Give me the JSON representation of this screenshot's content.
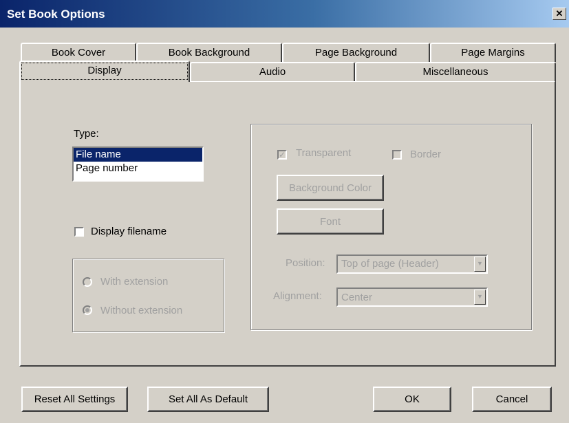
{
  "window": {
    "title": "Set Book Options",
    "close_glyph": "✕"
  },
  "tabs": {
    "row_back": [
      "Book Cover",
      "Book Background",
      "Page Background",
      "Page Margins"
    ],
    "row_front": [
      "Display",
      "Audio",
      "Miscellaneous"
    ],
    "selected": "Display"
  },
  "display": {
    "type_label": "Type:",
    "type_options": [
      "File name",
      "Page number"
    ],
    "type_selected": "File name",
    "display_filename_label": "Display filename",
    "display_filename_checked": false,
    "with_extension_label": "With extension",
    "without_extension_label": "Without extension",
    "extension_selected": "Without extension",
    "transparent_label": "Transparent",
    "transparent_checked": true,
    "border_label": "Border",
    "border_checked": false,
    "background_color_label": "Background Color",
    "font_label": "Font",
    "position_label": "Position:",
    "position_value": "Top of page (Header)",
    "alignment_label": "Alignment:",
    "alignment_value": "Center"
  },
  "footer": {
    "reset_label": "Reset All Settings",
    "set_default_label": "Set All As Default",
    "ok_label": "OK",
    "cancel_label": "Cancel"
  }
}
